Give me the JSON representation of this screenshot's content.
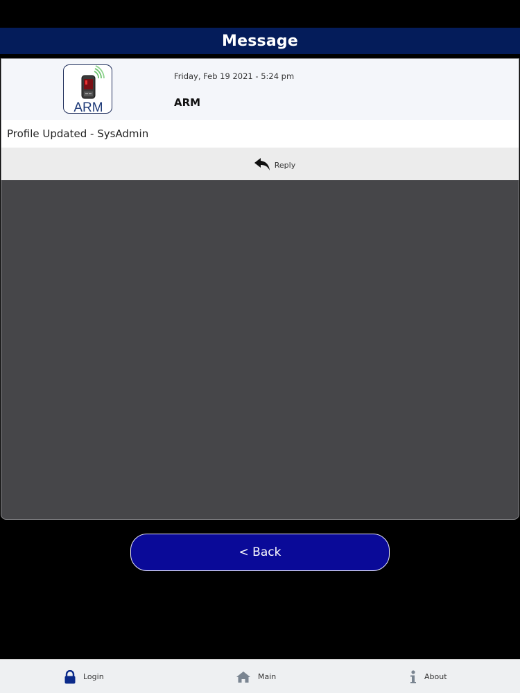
{
  "header": {
    "title": "Message"
  },
  "message": {
    "logo_text": "ARM",
    "date": "Friday, Feb 19 2021 - 5:24 pm",
    "sender": "ARM",
    "body": "Profile Updated - SysAdmin",
    "reply_label": "Reply"
  },
  "back_button": {
    "label": "< Back"
  },
  "tabbar": {
    "items": [
      {
        "label": "Login",
        "icon": "lock-icon"
      },
      {
        "label": "Main",
        "icon": "home-icon"
      },
      {
        "label": "About",
        "icon": "info-icon"
      }
    ]
  },
  "colors": {
    "header_bg": "#041c5a",
    "panel_bg": "#464649",
    "back_button_bg": "#0a0a98",
    "tab_icon_lock": "#0b2a8a",
    "tab_icon_home": "#7a8591"
  }
}
